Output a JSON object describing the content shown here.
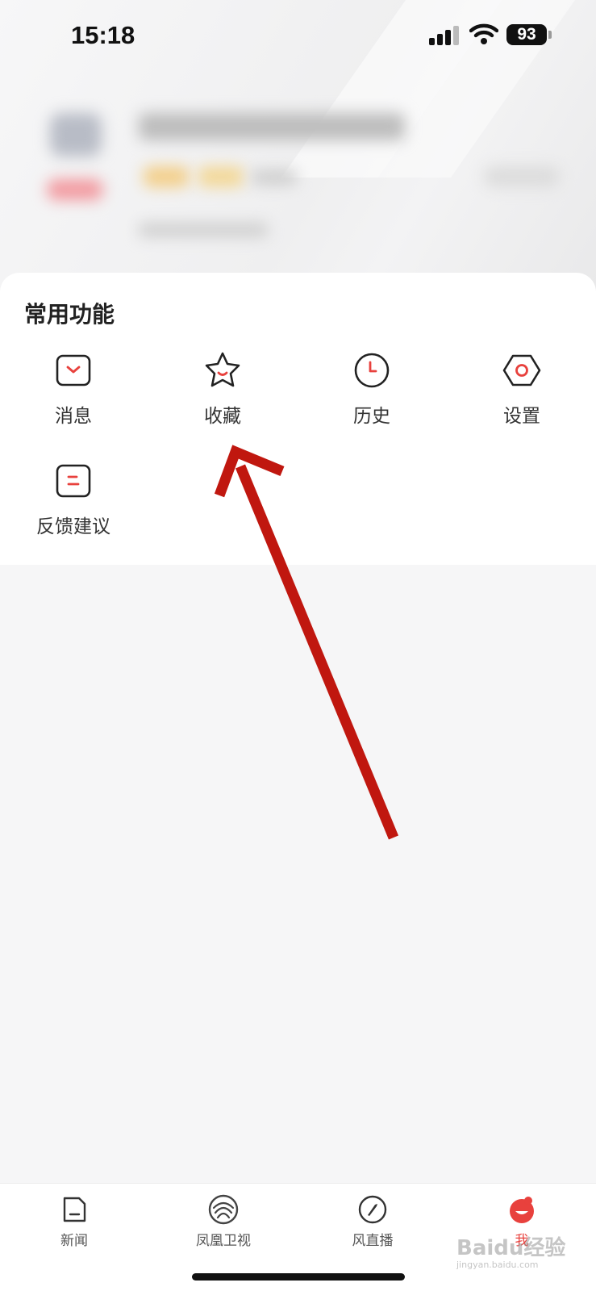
{
  "status_bar": {
    "time": "15:18",
    "battery": "93"
  },
  "functions": {
    "title": "常用功能",
    "items": [
      {
        "label": "消息",
        "icon": "message-icon"
      },
      {
        "label": "收藏",
        "icon": "star-icon"
      },
      {
        "label": "历史",
        "icon": "clock-icon"
      },
      {
        "label": "设置",
        "icon": "gear-hexagon-icon"
      },
      {
        "label": "反馈建议",
        "icon": "feedback-icon"
      }
    ]
  },
  "tab_bar": {
    "tabs": [
      {
        "label": "新闻",
        "icon": "news-icon",
        "active": false
      },
      {
        "label": "凤凰卫视",
        "icon": "phoenix-logo-icon",
        "active": false
      },
      {
        "label": "风直播",
        "icon": "compass-icon",
        "active": false
      },
      {
        "label": "我",
        "icon": "profile-icon",
        "active": true
      }
    ]
  },
  "watermark": {
    "main": "Baidu经验",
    "sub": "jingyan.baidu.com"
  },
  "colors": {
    "accent": "#e8413d",
    "annotation_arrow": "#c0170f",
    "icon_stroke": "#222222",
    "card_bg": "#ffffff",
    "page_bg": "#f6f6f7"
  }
}
